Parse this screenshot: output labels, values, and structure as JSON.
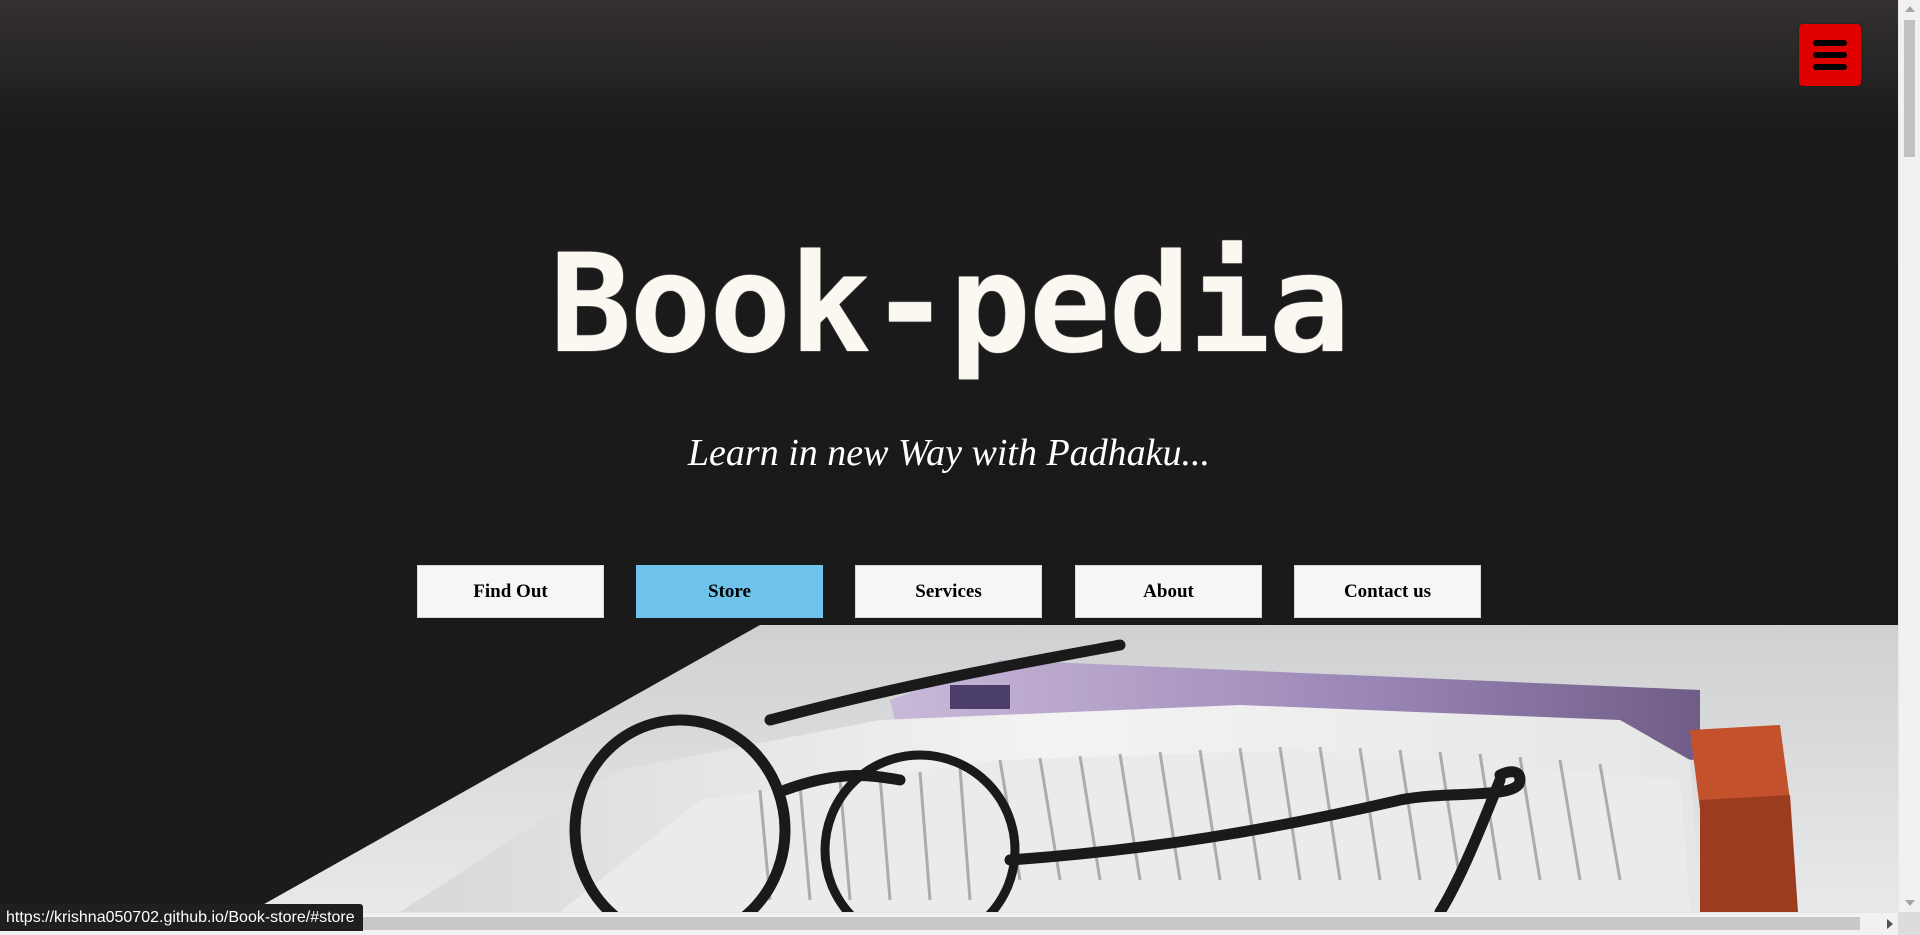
{
  "hero": {
    "title": "Book-pedia",
    "tagline": "Learn in new Way with Padhaku..."
  },
  "menu": {
    "icon": "hamburger-icon",
    "color": "#e10000"
  },
  "nav": {
    "items": [
      {
        "label": "Find Out",
        "active": false
      },
      {
        "label": "Store",
        "active": true
      },
      {
        "label": "Services",
        "active": false
      },
      {
        "label": "About",
        "active": false
      },
      {
        "label": "Contact us",
        "active": false
      }
    ],
    "active_color": "#6ec3ea"
  },
  "status_bar": {
    "url": "https://krishna050702.github.io/Book-store/#store"
  }
}
